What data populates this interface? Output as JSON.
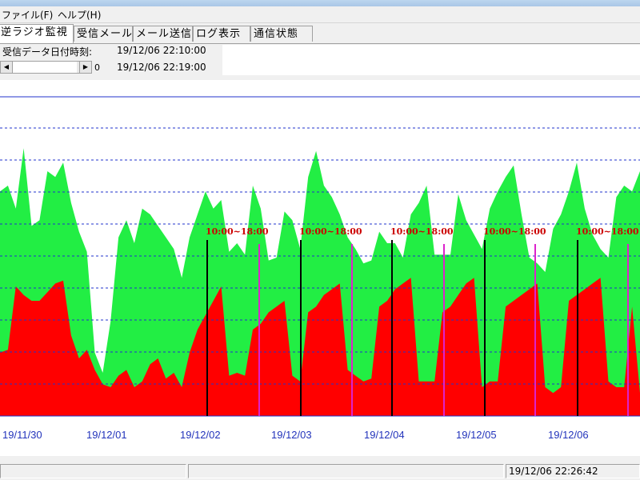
{
  "menu": {
    "file": "ファイル(F)",
    "help": "ヘルプ(H)"
  },
  "tabs": [
    "逆ラジオ監視",
    "受信メール",
    "メール送信",
    "ログ表示",
    "通信状態"
  ],
  "info": {
    "received_label": "受信データ日付時刻:",
    "date_from": "19/12/06 22:10:00",
    "date_to": "19/12/06 22:19:00",
    "scroll_value": "0"
  },
  "colors": {
    "green": "#22ee44",
    "red": "#ff0000",
    "gridline": "#2233cc",
    "annotation": "#cc0000",
    "magenta_marker": "#dd22cc"
  },
  "chart_data": {
    "type": "area",
    "x_tick_labels": [
      "19/11/30",
      "19/12/01",
      "19/12/02",
      "19/12/03",
      "19/12/04",
      "19/12/05",
      "19/12/06"
    ],
    "annotations": [
      "10:00~18:00",
      "10:00~18:00",
      "10:00~18:00",
      "10:00~18:00",
      "10:00~18:00"
    ],
    "grid": true,
    "series": [
      {
        "color": "#22ee44",
        "values": [
          78,
          80,
          72,
          93,
          66,
          68,
          85,
          83,
          88,
          74,
          64,
          57,
          22,
          15,
          33,
          62,
          68,
          60,
          72,
          70,
          66,
          62,
          58,
          48,
          62,
          70,
          78,
          72,
          75,
          57,
          60,
          56,
          80,
          72,
          54,
          55,
          71,
          68,
          58,
          83,
          92,
          80,
          76,
          70,
          62,
          58,
          53,
          54,
          64,
          60,
          60,
          55,
          70,
          74,
          80,
          56,
          56,
          56,
          77,
          68,
          63,
          58,
          72,
          78,
          83,
          87,
          70,
          55,
          53,
          50,
          65,
          70,
          78,
          88,
          72,
          63,
          58,
          55,
          76,
          80,
          78,
          85
        ]
      },
      {
        "color": "#ff0000",
        "values": [
          22,
          23,
          45,
          42,
          40,
          40,
          43,
          46,
          47,
          28,
          20,
          23,
          16,
          11,
          10,
          14,
          16,
          10,
          12,
          18,
          20,
          13,
          15,
          10,
          22,
          30,
          35,
          40,
          45,
          14,
          15,
          14,
          30,
          32,
          36,
          38,
          40,
          14,
          12,
          36,
          38,
          42,
          44,
          46,
          16,
          14,
          12,
          13,
          38,
          40,
          44,
          46,
          48,
          12,
          12,
          12,
          36,
          38,
          42,
          46,
          48,
          10,
          12,
          12,
          38,
          40,
          42,
          44,
          46,
          10,
          8,
          10,
          40,
          42,
          44,
          46,
          48,
          12,
          10,
          10,
          38,
          8
        ]
      }
    ]
  },
  "status": {
    "panel1": "",
    "panel2": "",
    "clock": "19/12/06 22:26:42"
  }
}
